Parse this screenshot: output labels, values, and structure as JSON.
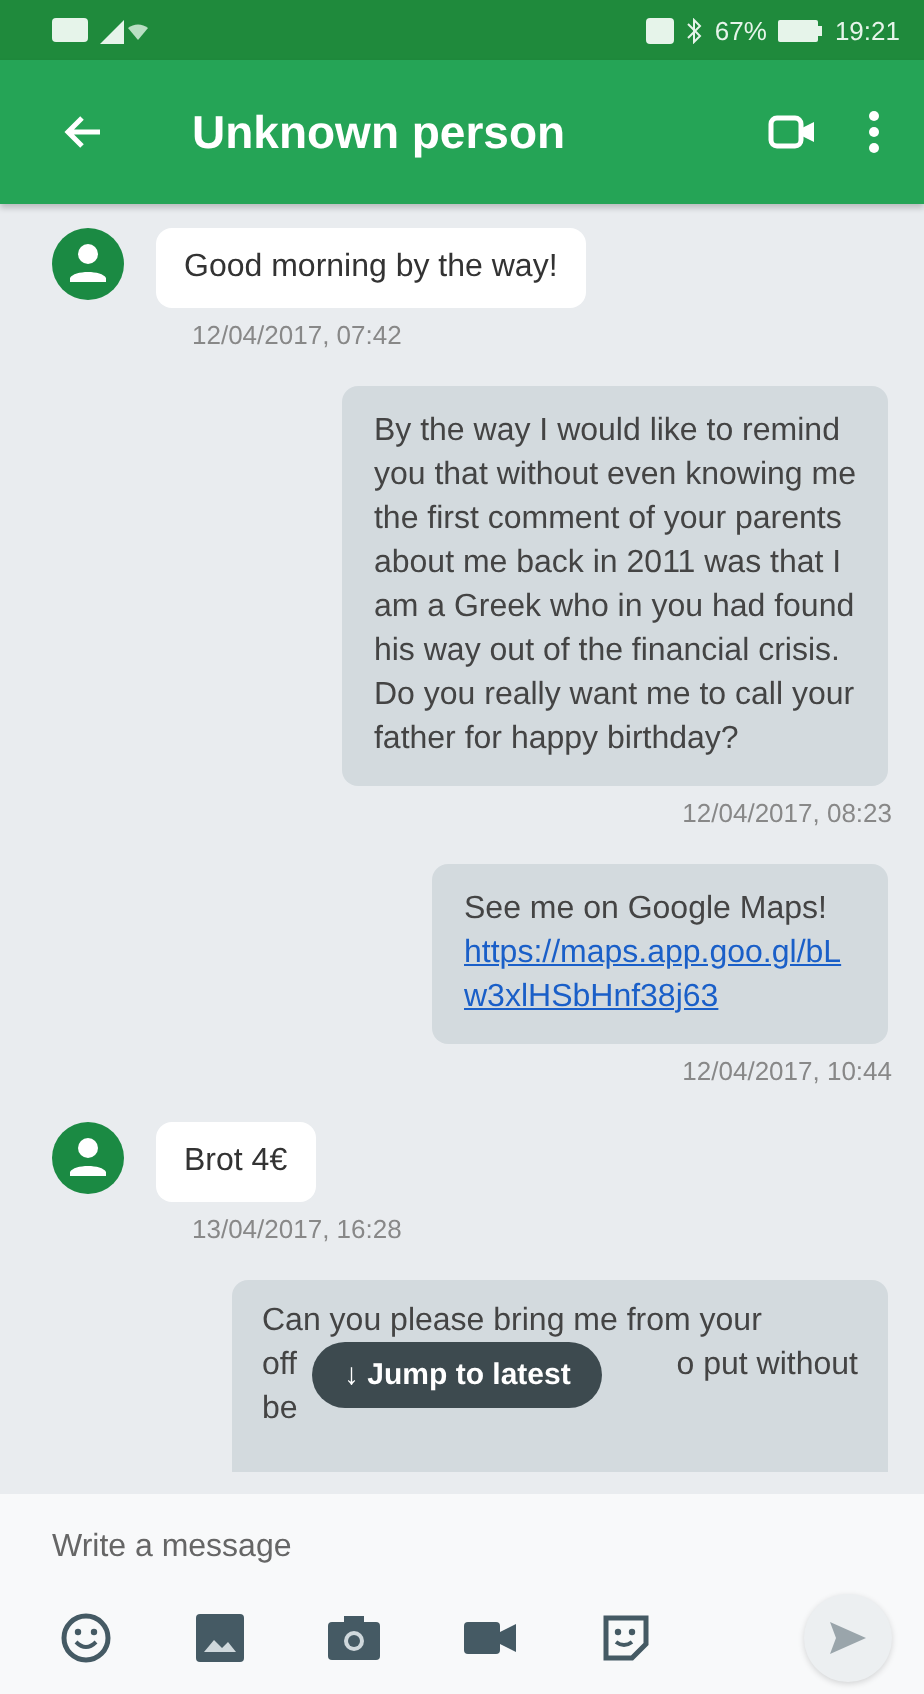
{
  "status_bar": {
    "battery": "67%",
    "time": "19:21"
  },
  "app_bar": {
    "title": "Unknown person"
  },
  "messages": [
    {
      "kind": "incoming",
      "text": "Good morning by the way!",
      "time": "12/04/2017, 07:42"
    },
    {
      "kind": "outgoing",
      "text": "By the way I would like to remind\nyou that without even knowing me\nthe first comment of your parents\nabout me back in 2011 was that I\nam a Greek who in you had found\nhis way out of the financial crisis.\nDo you really want me to call your\nfather for happy birthday?",
      "time": "12/04/2017, 08:23"
    },
    {
      "kind": "outgoing",
      "text": "See me on Google Maps!",
      "link": "https://maps.app.goo.gl/bLw3xlHSbHnf38j63",
      "time": "12/04/2017, 10:44"
    },
    {
      "kind": "incoming",
      "text": "Brot 4€",
      "time": "13/04/2017, 16:28"
    },
    {
      "kind": "partial",
      "lines": [
        [
          "Can you please bring me from your"
        ],
        [
          "off",
          "o put without"
        ],
        [
          "be"
        ]
      ]
    }
  ],
  "jump_button": {
    "label": "↓ Jump to latest"
  },
  "composer": {
    "placeholder": "Write a message"
  }
}
